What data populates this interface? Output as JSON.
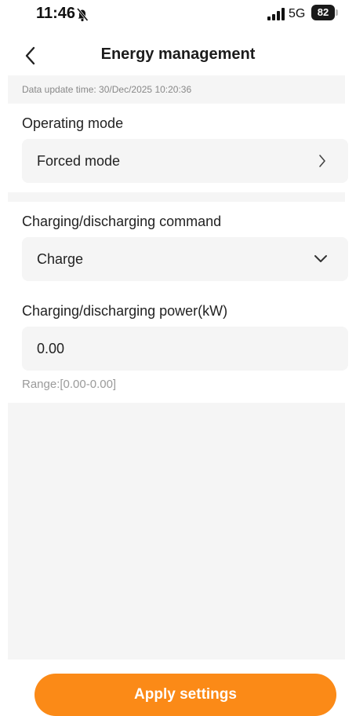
{
  "status_bar": {
    "time": "11:46",
    "network": "5G",
    "battery": "82",
    "icons": [
      "bell-slash-icon",
      "signal-icon"
    ]
  },
  "nav": {
    "title": "Energy management",
    "back_icon": "chevron-left-icon"
  },
  "update_time": "Data update time: 30/Dec/2025 10:20:36",
  "operating_mode": {
    "label": "Operating mode",
    "value": "Forced mode",
    "icon": "chevron-right-icon"
  },
  "command": {
    "label": "Charging/discharging command",
    "value": "Charge",
    "icon": "chevron-down-icon"
  },
  "power": {
    "label": "Charging/discharging power(kW)",
    "value": "0.00",
    "range": "Range:[0.00-0.00]"
  },
  "apply_button": "Apply settings",
  "colors": {
    "accent": "#fb8a17",
    "field_bg": "#f5f5f5"
  }
}
